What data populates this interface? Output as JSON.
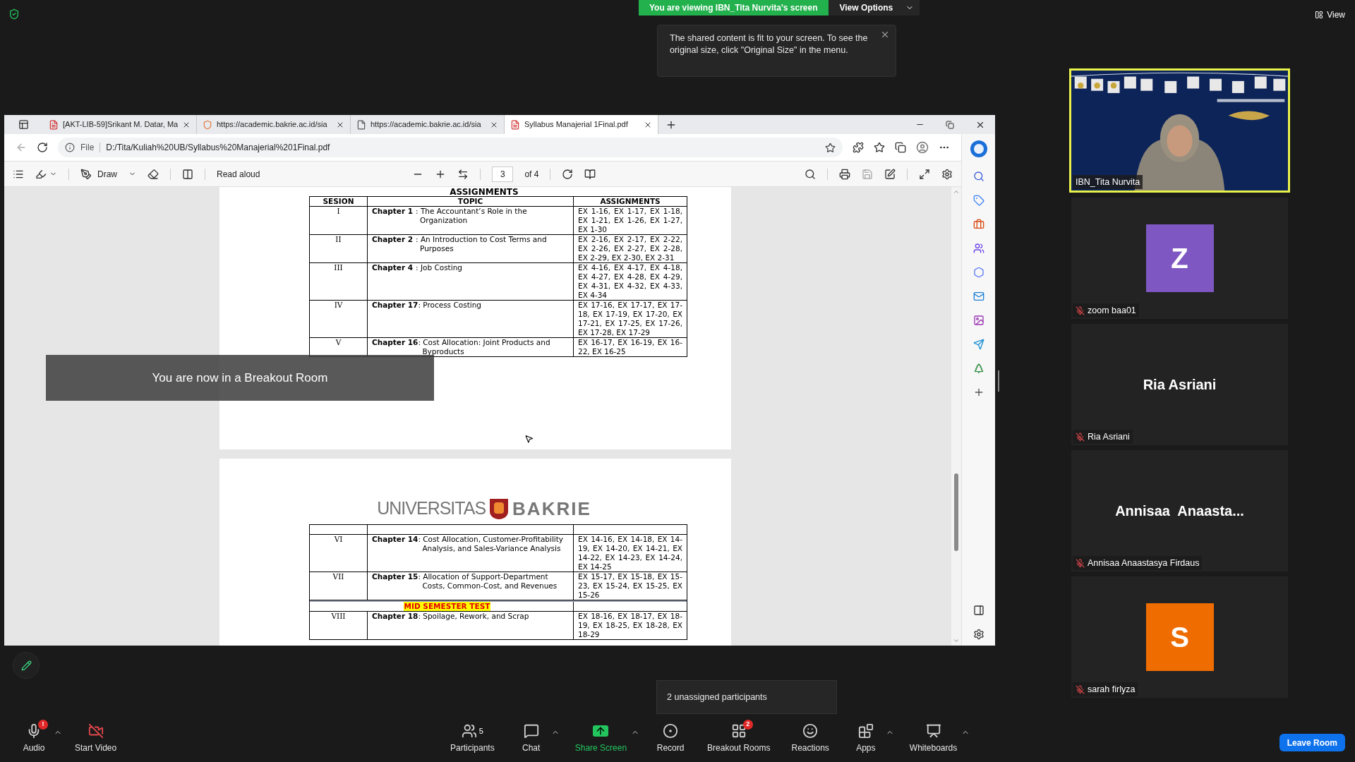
{
  "top": {
    "sharing_banner": "You are viewing IBN_Tita Nurvita's screen",
    "view_options": "View Options",
    "view": "View"
  },
  "notice": "The shared content is fit to your screen. To see the original size, click \"Original Size\" in the menu.",
  "browser": {
    "tabs": [
      {
        "kind": "pdf",
        "title": "[AKT-LIB-59]Srikant M. Datar, Ma",
        "selected": false
      },
      {
        "kind": "shield",
        "title": "https://academic.bakrie.ac.id/sia",
        "selected": false
      },
      {
        "kind": "page",
        "title": "https://academic.bakrie.ac.id/sia",
        "selected": false
      },
      {
        "kind": "pdf",
        "title": "Syllabus Manajerial 1Final.pdf",
        "selected": true
      }
    ],
    "address": {
      "label": "File",
      "url": "D:/Tita/Kuliah%20UB/Syllabus%20Manajerial%201Final.pdf"
    },
    "pdf_toolbar": {
      "draw": "Draw",
      "read_aloud": "Read aloud",
      "page": "3",
      "page_count": "of 4"
    }
  },
  "pages": [
    {
      "title": "ASSIGNMENTS",
      "columns": [
        "SESION",
        "TOPIC",
        "ASSIGNMENTS"
      ],
      "rows": [
        {
          "kind": "chapter",
          "session": "I",
          "chapter": "Chapter 1",
          "topic": ": The Accountant’s Role in the Organization",
          "assignments": "EX 1-16, EX 1-17, EX 1-18, EX 1-21, EX 1-26, EX 1-27, EX 1-30"
        },
        {
          "kind": "chapter",
          "session": "II",
          "chapter": "Chapter 2",
          "topic": ": An Introduction to Cost Terms and Purposes",
          "assignments": "EX 2-16, EX 2-17, EX 2-22, EX 2-26, EX 2-27, EX 2-28, EX 2-29, EX 2-30, EX 2-31"
        },
        {
          "kind": "chapter",
          "session": "III",
          "chapter": "Chapter 4",
          "topic": ": Job Costing",
          "assignments": "EX 4-16, EX 4-17, EX 4-18, EX 4-27, EX 4-28, EX 4-29, EX 4-31, EX 4-32, EX 4-33, EX 4-34"
        },
        {
          "kind": "chapter",
          "session": "IV",
          "chapter": "Chapter 17",
          "topic": ": Process Costing",
          "assignments": "EX 17-16, EX 17-17, EX 17-18, EX 17-19, EX 17-20, EX 17-21, EX 17-25, EX 17-26, EX 17-28, EX 17-29"
        },
        {
          "kind": "chapter",
          "session": "V",
          "chapter": "Chapter 16",
          "topic": ": Cost Allocation: Joint Products and Byproducts",
          "assignments": "EX 16-17, EX 16-19, EX 16-22, EX 16-25"
        }
      ]
    },
    {
      "logo": {
        "left": "UNIVERSITAS",
        "right": "BAKRIE"
      },
      "rows": [
        {
          "kind": "blank"
        },
        {
          "kind": "chapter",
          "session": "VI",
          "chapter": "Chapter 14",
          "topic": ": Cost Allocation, Customer-Profitability Analysis, and Sales-Variance Analysis",
          "assignments": "EX 14-16, EX 14-18, EX 14-19, EX 14-20, EX 14-21, EX 14-22, EX 14-23, EX 14-24, EX 14-25"
        },
        {
          "kind": "chapter",
          "session": "VII",
          "chapter": "Chapter 15",
          "topic": ": Allocation of Support-Department Costs, Common-Cost, and Revenues",
          "assignments": "EX 15-17, EX 15-18, EX 15-23, EX 15-24, EX 15-25, EX 15-26"
        },
        {
          "kind": "break",
          "label": "MID SEMESTER TEST"
        },
        {
          "kind": "chapter",
          "session": "VIII",
          "chapter": "Chapter 18",
          "topic": ": Spoilage, Rework, and Scrap",
          "assignments": "EX 18-16, EX 18-17, EX 18-19, EX 18-25, EX 18-28, EX 18-29"
        }
      ]
    }
  ],
  "breakout_notice": "You are now in a Breakout Room",
  "participants": [
    {
      "kind": "video",
      "name": "IBN_Tita Nurvita",
      "muted": false,
      "speaking": true
    },
    {
      "kind": "avatar",
      "initial": "Z",
      "color": "#7e57c2",
      "name": "zoom baa01",
      "muted": true,
      "speaking": false
    },
    {
      "kind": "name",
      "display": "Ria Asriani",
      "name": "Ria Asriani",
      "muted": true,
      "speaking": false
    },
    {
      "kind": "name",
      "display": "Annisaa  Anaasta...",
      "name": "Annisaa Anaastasya Firdaus",
      "muted": true,
      "speaking": false
    },
    {
      "kind": "avatar",
      "initial": "S",
      "color": "#ef6c00",
      "name": "sarah firlyza",
      "muted": true,
      "speaking": false
    }
  ],
  "toolbar": {
    "left": [
      {
        "kind": "audio",
        "label": "Audio",
        "badge": "!",
        "caret": true
      },
      {
        "kind": "video",
        "label": "Start Video"
      }
    ],
    "center": [
      {
        "kind": "participants",
        "label": "Participants",
        "count": "5"
      },
      {
        "kind": "chat",
        "label": "Chat",
        "caret": true
      },
      {
        "kind": "share",
        "label": "Share Screen",
        "caret": true
      },
      {
        "kind": "record",
        "label": "Record"
      },
      {
        "kind": "breakout",
        "label": "Breakout Rooms",
        "badge": "2"
      },
      {
        "kind": "reactions",
        "label": "Reactions"
      },
      {
        "kind": "apps",
        "label": "Apps",
        "caret": true
      },
      {
        "kind": "whiteboards",
        "label": "Whiteboards",
        "caret": true
      }
    ],
    "leave": "Leave Room",
    "tip": "2 unassigned participants"
  }
}
